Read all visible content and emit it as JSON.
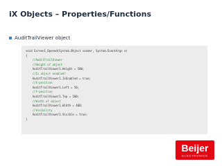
{
  "slide": {
    "title": "iX Objects – Properties/Functions",
    "bullet": "AuditTrailViewer object"
  },
  "code_lines": [
    {
      "text": "void Screen1_Opened(System.Object sender, System.EventArgs e)",
      "kind": "code"
    },
    {
      "text": "{",
      "kind": "code"
    },
    {
      "text": "    //AuditTrailViewer",
      "kind": "comment"
    },
    {
      "text": "    //Height of object",
      "kind": "comment"
    },
    {
      "text": "    AuditTrailViewer1.Height = 500;",
      "kind": "code"
    },
    {
      "text": "    //Is object enabled?",
      "kind": "comment"
    },
    {
      "text": "    AuditTrailViewer1.IsEnabled = true;",
      "kind": "code"
    },
    {
      "text": "    //X-position",
      "kind": "comment"
    },
    {
      "text": "    AuditTrailViewer1.Left = 50;",
      "kind": "code"
    },
    {
      "text": "    //Y-position",
      "kind": "comment"
    },
    {
      "text": "    AuditTrailViewer1.Top = 100;",
      "kind": "code"
    },
    {
      "text": "    //Width of object",
      "kind": "comment"
    },
    {
      "text": "    AuditTrailViewer1.Width = 400;",
      "kind": "code"
    },
    {
      "text": "    //Visibility",
      "kind": "comment"
    },
    {
      "text": "    AuditTrailViewer1.Visible = true;",
      "kind": "code"
    },
    {
      "text": "}",
      "kind": "code"
    }
  ],
  "logo": {
    "name": "Beijer",
    "sub": "ELECTRONICS",
    "colors": {
      "background": "#e30613",
      "text": "#ffffff"
    }
  },
  "colors": {
    "title": "#1f2d3d",
    "bullet": "#3b86c6",
    "code_background": "#ececec",
    "comment": "#2f8f3f"
  }
}
